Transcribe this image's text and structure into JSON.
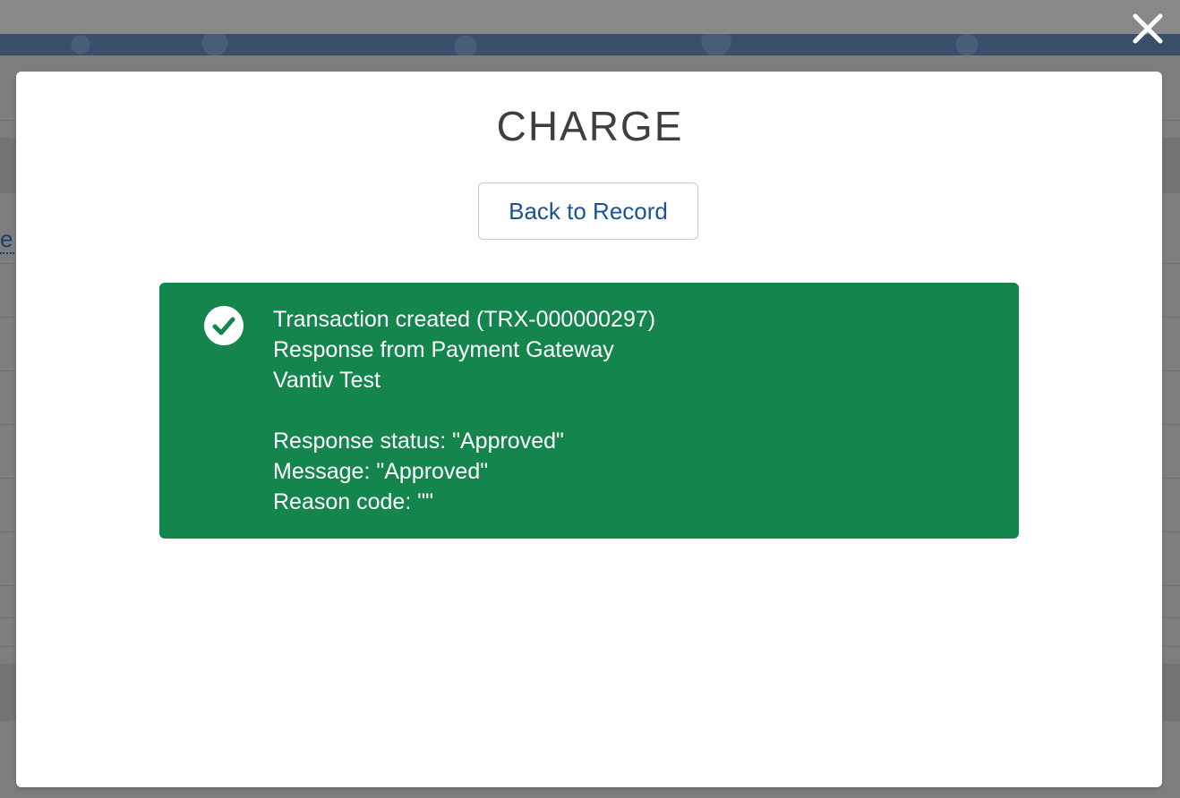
{
  "modal": {
    "title": "CHARGE",
    "back_button_label": "Back to Record",
    "close_icon": "close-icon"
  },
  "toast": {
    "icon": "success-check-icon",
    "color": "#14854d",
    "lines": [
      "Transaction created (TRX-000000297)",
      "Response from Payment Gateway",
      "Vantiv Test"
    ],
    "details": [
      "Response status: \"Approved\"",
      "Message: \"Approved\"",
      "Reason code: \"\""
    ]
  },
  "background": {
    "link_fragment": "e"
  }
}
